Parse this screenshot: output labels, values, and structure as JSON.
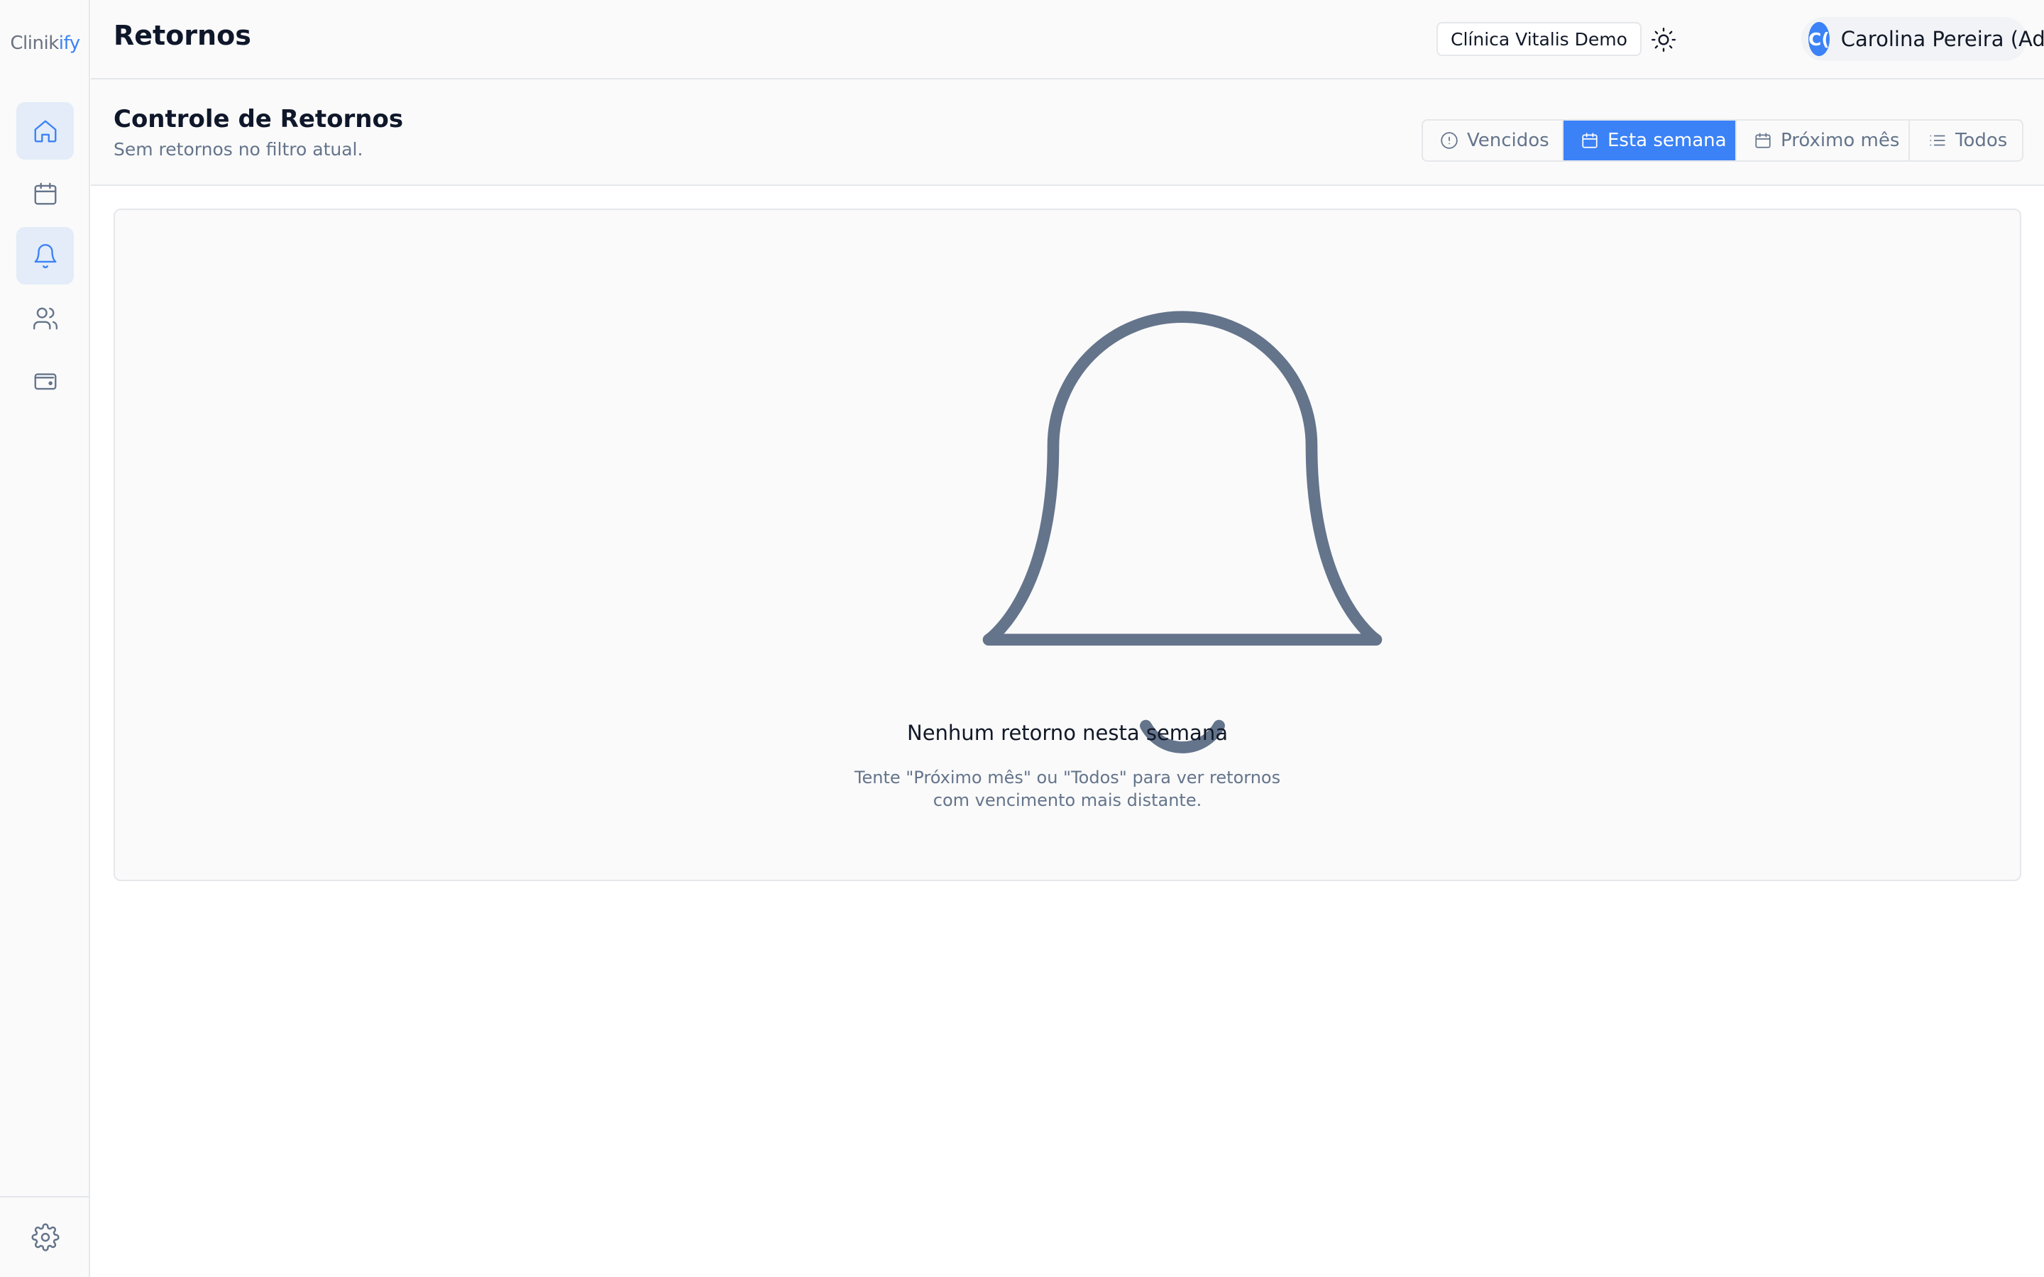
{
  "app": {
    "logo_main": "Clinik",
    "logo_accent": "ify"
  },
  "sidebar": {
    "items": [
      {
        "name": "home",
        "icon": "home-icon",
        "active": true
      },
      {
        "name": "calendar",
        "icon": "calendar-icon",
        "active": false
      },
      {
        "name": "retornos",
        "icon": "bell-icon",
        "active": true
      },
      {
        "name": "patients",
        "icon": "users-icon",
        "active": false
      },
      {
        "name": "finance",
        "icon": "wallet-icon",
        "active": false
      }
    ],
    "bottom_icon": "gear-icon"
  },
  "header": {
    "title": "Retornos",
    "clinic": "Clínica Vitalis Demo",
    "theme_icon": "sun-icon",
    "user": {
      "initials": "C(",
      "name": "Carolina Pereira (Admin)"
    }
  },
  "section": {
    "title": "Controle de Retornos",
    "subtitle": "Sem retornos no filtro atual."
  },
  "filters": [
    {
      "label": "Vencidos",
      "icon": "alert-circle-icon",
      "active": false
    },
    {
      "label": "Esta semana",
      "icon": "calendar-icon",
      "active": true
    },
    {
      "label": "Próximo mês",
      "icon": "calendar-icon",
      "active": false
    },
    {
      "label": "Todos",
      "icon": "list-icon",
      "active": false
    }
  ],
  "empty_state": {
    "icon": "bell-icon",
    "title": "Nenhum retorno nesta semana",
    "description_line1": "Tente \"Próximo mês\" ou \"Todos\" para ver retornos",
    "description_line2": "com vencimento mais distante."
  },
  "colors": {
    "accent": "#3b82f6",
    "active_nav_bg": "#e3ecf8",
    "muted_text": "#64748b",
    "icon_gray": "#64748b"
  }
}
